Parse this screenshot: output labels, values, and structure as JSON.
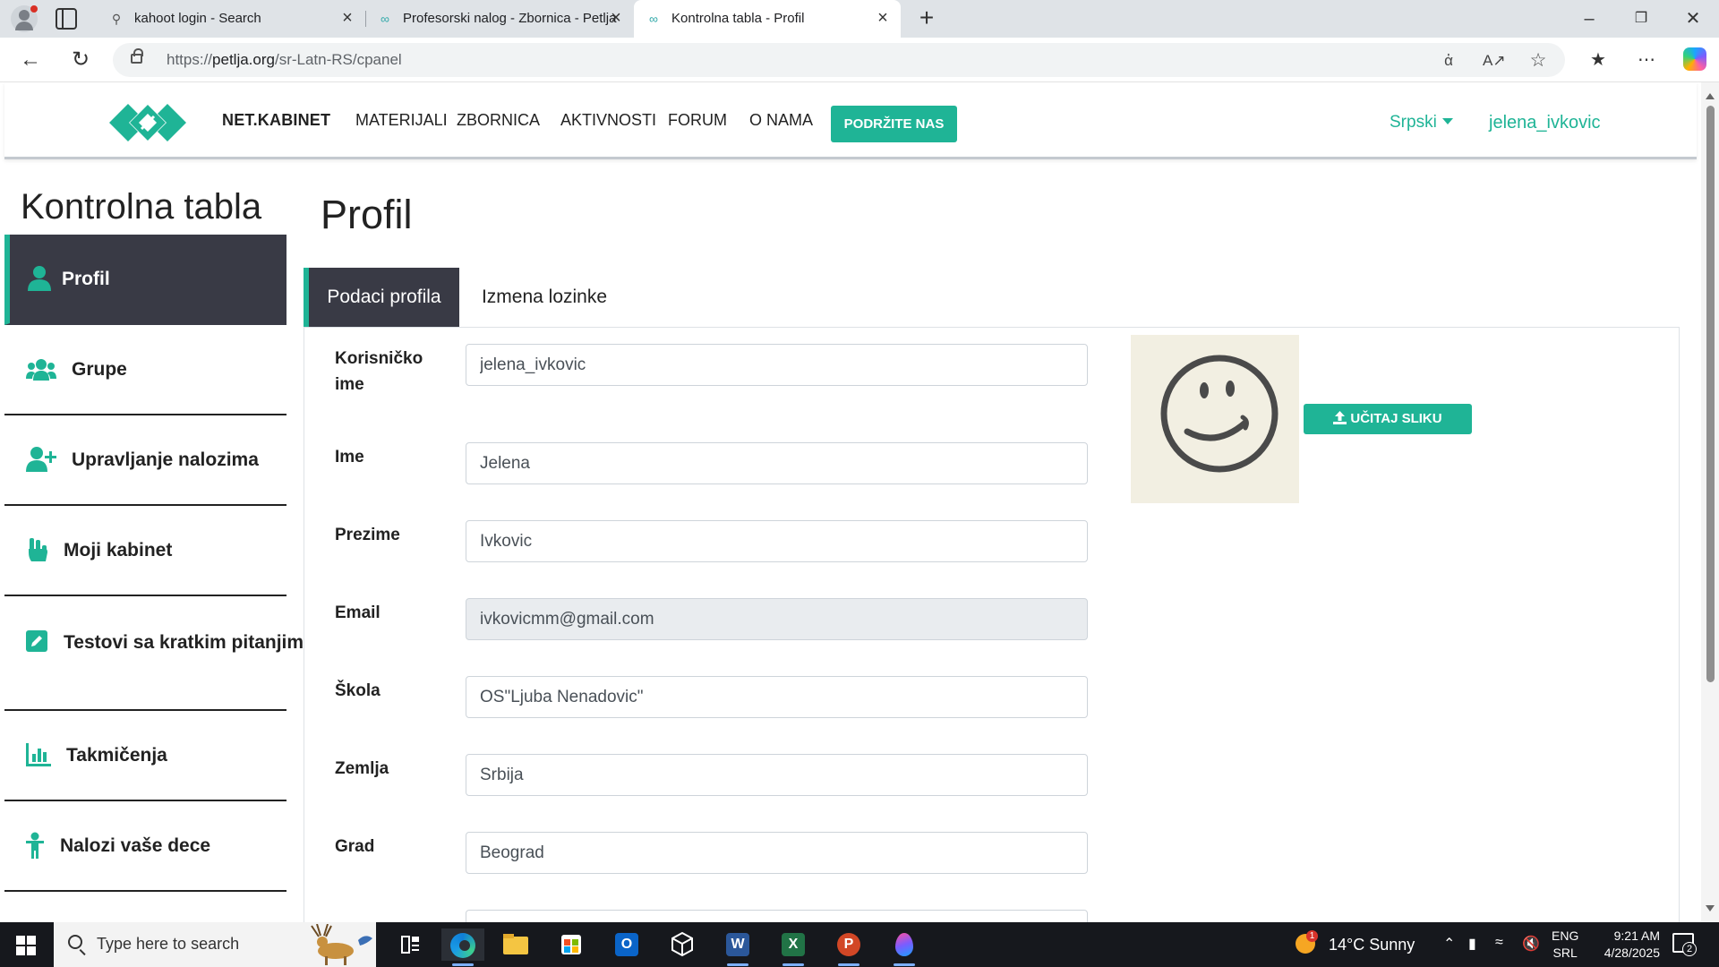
{
  "browser": {
    "tabs": [
      {
        "title": "kahoot login - Search",
        "icon": "search-icon"
      },
      {
        "title": "Profesorski nalog - Zbornica - Petlja",
        "icon": "petlja-icon"
      },
      {
        "title": "Kontrolna tabla - Profil",
        "icon": "petlja-icon"
      }
    ],
    "url_prefix": "https://",
    "url_host": "petlja.org",
    "url_path": "/sr-Latn-RS/cpanel"
  },
  "site_nav": {
    "brand": "NET.KABINET",
    "menu": [
      "MATERIJALI",
      "ZBORNICA",
      "AKTIVNOSTI",
      "FORUM",
      "O NAMA"
    ],
    "support_button": "PODRŽITE NAS",
    "language": "Srpski",
    "username": "jelena_ivkovic",
    "accent_color": "#1fb496"
  },
  "sidebar": {
    "title": "Kontrolna tabla",
    "items": [
      {
        "label": "Profil",
        "icon": "user-icon",
        "active": true
      },
      {
        "label": "Grupe",
        "icon": "users-icon",
        "active": false
      },
      {
        "label": "Upravljanje nalozima",
        "icon": "user-plus-icon",
        "active": false
      },
      {
        "label": "Moji kabinet",
        "icon": "hand-icon",
        "active": false
      },
      {
        "label": "Testovi sa kratkim pitanjima",
        "icon": "edit-icon",
        "active": false
      },
      {
        "label": "Takmičenja",
        "icon": "bar-chart-icon",
        "active": false
      },
      {
        "label": "Nalozi vaše dece",
        "icon": "child-icon",
        "active": false
      }
    ]
  },
  "main": {
    "title": "Profil",
    "tabs": [
      {
        "label": "Podaci profila",
        "active": true
      },
      {
        "label": "Izmena lozinke",
        "active": false
      }
    ],
    "fields": [
      {
        "label": "Korisničko ime",
        "value": "jelena_ivkovic",
        "readonly": false
      },
      {
        "label": "Ime",
        "value": "Jelena",
        "readonly": false
      },
      {
        "label": "Prezime",
        "value": "Ivkovic",
        "readonly": false
      },
      {
        "label": "Email",
        "value": "ivkovicmm@gmail.com",
        "readonly": true
      },
      {
        "label": "Škola",
        "value": "OS\"Ljuba Nenadovic\"",
        "readonly": false
      },
      {
        "label": "Zemlja",
        "value": "Srbija",
        "readonly": false
      },
      {
        "label": "Grad",
        "value": "Beograd",
        "readonly": false
      }
    ],
    "upload_button": "UČITAJ SLIKU"
  },
  "taskbar": {
    "search_placeholder": "Type here to search",
    "weather": "14°C  Sunny",
    "weather_badge": "1",
    "lang_line1": "ENG",
    "lang_line2": "SRL",
    "time": "9:21 AM",
    "date": "4/28/2025",
    "notifications": "2"
  }
}
